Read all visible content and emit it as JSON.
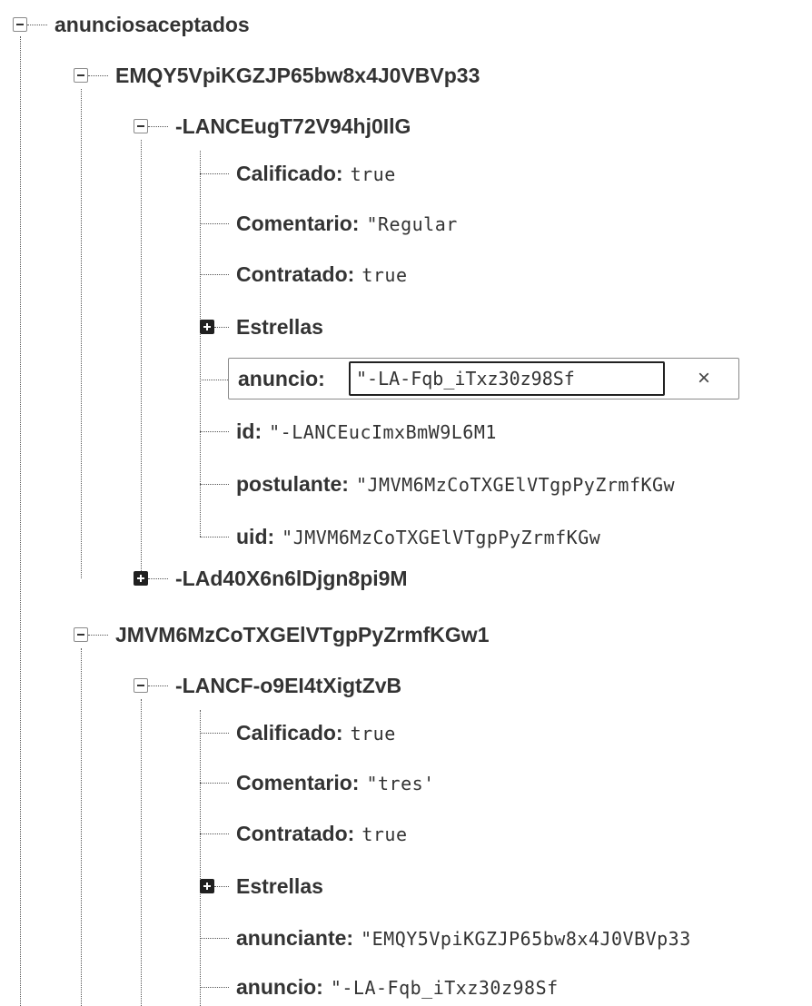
{
  "tree": {
    "root": {
      "key": "anunciosaceptados"
    },
    "users": [
      {
        "key": "EMQY5VpiKGZJP65bw8x4J0VBVp33",
        "items": [
          {
            "key": "-LANCEugT72V94hj0IlG",
            "fields": [
              {
                "key": "Calificado:",
                "value": "true"
              },
              {
                "key": "Comentario:",
                "value": "\"Regular"
              },
              {
                "key": "Contratado:",
                "value": "true"
              },
              {
                "key": "Estrellas",
                "collapsed": true
              },
              {
                "key": "anuncio:",
                "value": "\"-LA-Fqb_iTxz30z98Sf",
                "editing": true,
                "close_label": "×"
              },
              {
                "key": "id:",
                "value": "\"-LANCEucImxBmW9L6M1"
              },
              {
                "key": "postulante:",
                "value": "\"JMVM6MzCoTXGElVTgpPyZrmfKGw"
              },
              {
                "key": "uid:",
                "value": "\"JMVM6MzCoTXGElVTgpPyZrmfKGw"
              }
            ]
          },
          {
            "key": "-LAd40X6n6lDjgn8pi9M",
            "collapsed": true
          }
        ]
      },
      {
        "key": "JMVM6MzCoTXGElVTgpPyZrmfKGw1",
        "items": [
          {
            "key": "-LANCF-o9EI4tXigtZvB",
            "fields": [
              {
                "key": "Calificado:",
                "value": "true"
              },
              {
                "key": "Comentario:",
                "value": "\"tres'"
              },
              {
                "key": "Contratado:",
                "value": "true"
              },
              {
                "key": "Estrellas",
                "collapsed": true
              },
              {
                "key": "anunciante:",
                "value": "\"EMQY5VpiKGZJP65bw8x4J0VBVp33"
              },
              {
                "key": "anuncio:",
                "value": "\"-LA-Fqb_iTxz30z98Sf"
              }
            ]
          }
        ]
      }
    ]
  }
}
